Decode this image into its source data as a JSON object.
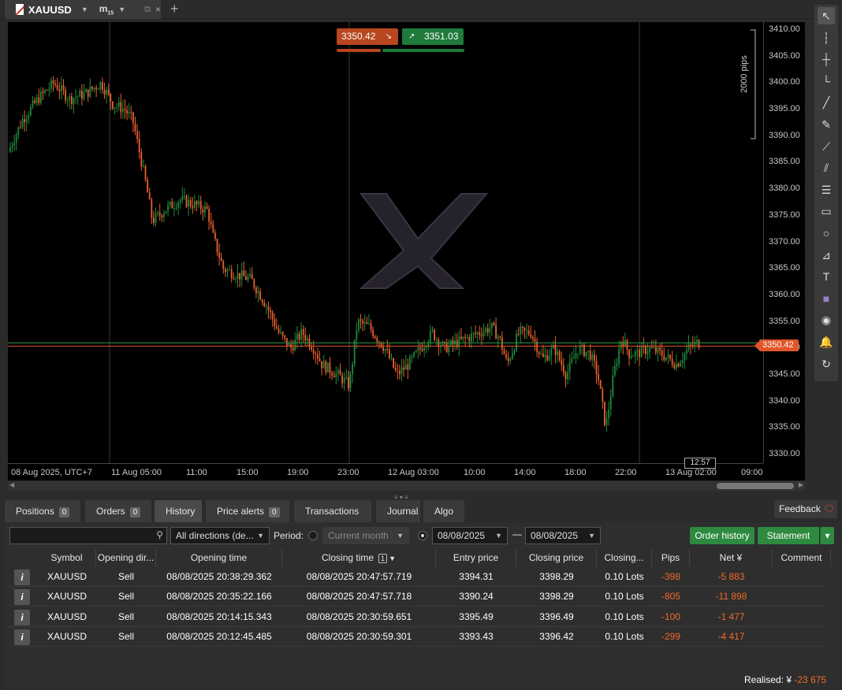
{
  "top_tab": {
    "symbol": "XAUUSD",
    "timeframe_main": "m",
    "timeframe_sub": "15",
    "add_tab_glyph": "+",
    "close_glyph": "×",
    "caret_glyph": "▼",
    "detach_glyph": "⧉"
  },
  "chart": {
    "bid": "3350.42",
    "ask": "3351.03",
    "bid_arrow": "↘",
    "ask_arrow": "↗",
    "current_price": "3350.42",
    "candle_timer": "12:57",
    "pips_label": "2000 pips",
    "price_ticks": [
      "3410.00",
      "3405.00",
      "3400.00",
      "3395.00",
      "3390.00",
      "3385.00",
      "3380.00",
      "3375.00",
      "3370.00",
      "3365.00",
      "3360.00",
      "3355.00",
      "3350.00",
      "3345.00",
      "3340.00",
      "3335.00",
      "3330.00"
    ],
    "time_ticks": [
      "08 Aug 2025, UTC+7",
      "11 Aug 05:00",
      "11:00",
      "15:00",
      "19:00",
      "23:00",
      "12 Aug 03:00",
      "10:00",
      "14:00",
      "18:00",
      "22:00",
      "13 Aug 02:00",
      "09:00"
    ],
    "colors": {
      "bull": "#1e8a3c",
      "bear": "#e8602e",
      "bid_line": "#e0562a",
      "ask_line": "#2a9a4a"
    }
  },
  "toolbar_icons": [
    "cursor-icon",
    "crosshair-vertical-icon",
    "crosshair-icon",
    "axis-icon",
    "trendline-icon",
    "pen-icon",
    "fan-icon",
    "pitchfork-icon",
    "fibonacci-icon",
    "rectangle-icon",
    "circle-icon",
    "channel-icon",
    "text-icon",
    "color-swatch-icon",
    "camera-icon",
    "bell-icon",
    "replay-icon"
  ],
  "bottom_tabs": [
    {
      "label": "Positions",
      "badge": "0"
    },
    {
      "label": "Orders",
      "badge": "0"
    },
    {
      "label": "History",
      "badge": ""
    },
    {
      "label": "Price alerts",
      "badge": "0"
    },
    {
      "label": "Transactions",
      "badge": ""
    },
    {
      "label": "Journal",
      "badge": ""
    },
    {
      "label": "Algo",
      "badge": ""
    }
  ],
  "feedback_label": "Feedback",
  "filters": {
    "search_placeholder": "",
    "directions": "All directions (de...",
    "period_label": "Period:",
    "current_month": "Current month",
    "date_from": "08/08/2025",
    "date_sep": "—",
    "date_to": "08/08/2025",
    "order_history": "Order history",
    "statement": "Statement"
  },
  "table": {
    "columns": [
      "Symbol",
      "Opening dir...",
      "Opening time",
      "Closing time",
      "Entry price",
      "Closing price",
      "Closing...",
      "Pips",
      "Net ¥",
      "Comment"
    ],
    "sort_badge": "1",
    "sort_arrow": "▼",
    "rows": [
      {
        "symbol": "XAUUSD",
        "dir": "Sell",
        "open": "08/08/2025 20:38:29.362",
        "close": "08/08/2025 20:47:57.719",
        "entry": "3394.31",
        "closep": "3398.29",
        "lots": "0.10 Lots",
        "pips": "-398",
        "net": "-5 883"
      },
      {
        "symbol": "XAUUSD",
        "dir": "Sell",
        "open": "08/08/2025 20:35:22.166",
        "close": "08/08/2025 20:47:57.718",
        "entry": "3390.24",
        "closep": "3398.29",
        "lots": "0.10 Lots",
        "pips": "-805",
        "net": "-11 898"
      },
      {
        "symbol": "XAUUSD",
        "dir": "Sell",
        "open": "08/08/2025 20:14:15.343",
        "close": "08/08/2025 20:30:59.651",
        "entry": "3395.49",
        "closep": "3396.49",
        "lots": "0.10 Lots",
        "pips": "-100",
        "net": "-1 477"
      },
      {
        "symbol": "XAUUSD",
        "dir": "Sell",
        "open": "08/08/2025 20:12:45.485",
        "close": "08/08/2025 20:30:59.301",
        "entry": "3393.43",
        "closep": "3396.42",
        "lots": "0.10 Lots",
        "pips": "-299",
        "net": "-4 417"
      }
    ],
    "info_glyph": "i"
  },
  "realised": {
    "label": "Realised: ¥",
    "value": "-23 675"
  }
}
